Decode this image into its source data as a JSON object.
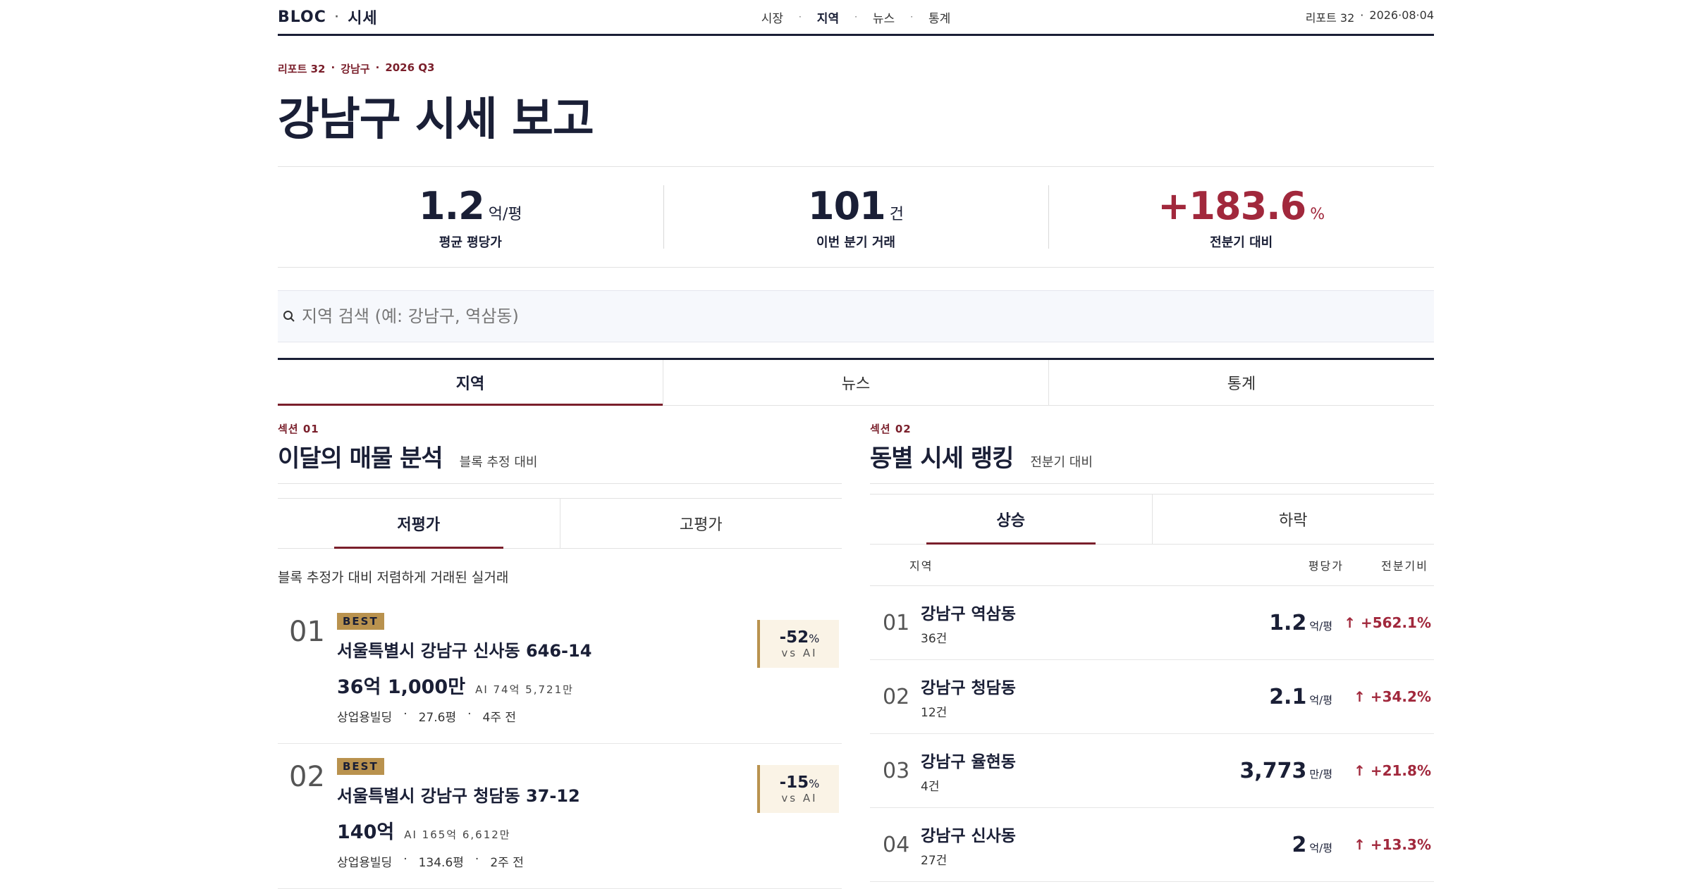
{
  "nav": {
    "brand": "BLOC",
    "brand_sub": "시세",
    "links": [
      "시장",
      "지역",
      "뉴스",
      "통계"
    ],
    "active": "지역",
    "report": "리포트 32",
    "date": "2026·08·04"
  },
  "report": {
    "kicker": [
      "리포트 32",
      "강남구",
      "2026 Q3"
    ],
    "title": "강남구 시세 보고"
  },
  "stats": [
    {
      "value": "1.2",
      "unit": "억/평",
      "label": "평균 평당가"
    },
    {
      "value": "101",
      "unit": "건",
      "label": "이번 분기 거래"
    },
    {
      "value": "+183.6",
      "unit": "%",
      "label": "전분기 대비"
    }
  ],
  "search": {
    "placeholder": "지역 검색 (예: 강남구, 역삼동)"
  },
  "main_tabs": [
    "지역",
    "뉴스",
    "통계"
  ],
  "section1": {
    "label": "섹션 01",
    "title": "이달의 매물 분석",
    "subtitle": "블록 추정 대비",
    "tabs": [
      "저평가",
      "고평가"
    ],
    "description": "블록 추정가 대비 저렴하게 거래된 실거래",
    "items": [
      {
        "rank": "01",
        "badge": "BEST",
        "address": "서울특별시 강남구 신사동 646-14",
        "price": "36억 1,000만",
        "ai": "AI 74억 5,721만",
        "type": "상업용빌딩",
        "area": "27.6평",
        "when": "4주 전",
        "discount": "-52",
        "discount_unit": "%",
        "vs": "vs AI"
      },
      {
        "rank": "02",
        "badge": "BEST",
        "address": "서울특별시 강남구 청담동 37-12",
        "price": "140억",
        "ai": "AI 165억 6,612만",
        "type": "상업용빌딩",
        "area": "134.6평",
        "when": "2주 전",
        "discount": "-15",
        "discount_unit": "%",
        "vs": "vs AI"
      }
    ]
  },
  "section2": {
    "label": "섹션 02",
    "title": "동별 시세 랭킹",
    "subtitle": "전분기 대비",
    "tabs": [
      "상승",
      "하락"
    ],
    "columns": [
      "지역",
      "평당가",
      "전분기비"
    ],
    "rows": [
      {
        "rank": "01",
        "district": "강남구 역삼동",
        "count": "36건",
        "price": "1.2",
        "unit": "억/평",
        "change": "↑ +562.1%"
      },
      {
        "rank": "02",
        "district": "강남구 청담동",
        "count": "12건",
        "price": "2.1",
        "unit": "억/평",
        "change": "↑ +34.2%"
      },
      {
        "rank": "03",
        "district": "강남구 율현동",
        "count": "4건",
        "price": "3,773",
        "unit": "만/평",
        "change": "↑ +21.8%"
      },
      {
        "rank": "04",
        "district": "강남구 신사동",
        "count": "27건",
        "price": "2",
        "unit": "억/평",
        "change": "↑ +13.3%"
      }
    ]
  },
  "colors": {
    "accent": "#7a1f2b",
    "positive": "#a1283c",
    "gold": "#b9924e",
    "ink": "#1a1f36"
  }
}
